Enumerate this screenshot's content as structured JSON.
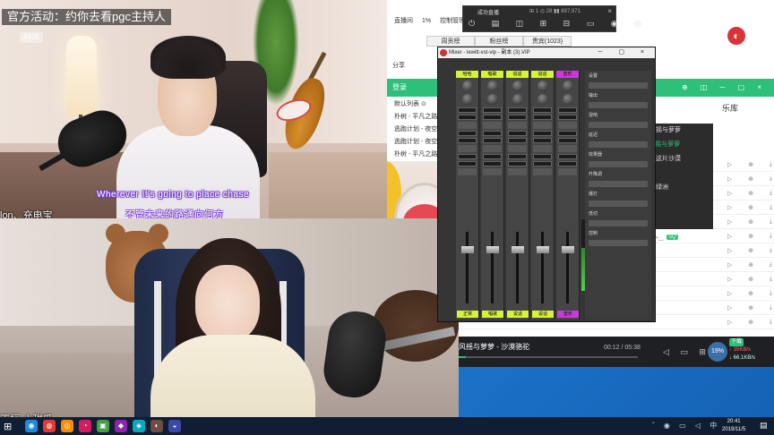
{
  "overlays": {
    "banner": "官方活动：约你去看pgc主持人",
    "game_name": "",
    "sub_badge": "8425",
    "lyric_en": "Wherever It's going to place chase",
    "lyric_cn": "不管未来的路通向何方",
    "streamer_top": "lon、充电宝",
    "streamer_bottom": "正恒-小甜瓜"
  },
  "stream_toolbar": {
    "title": "成功直播",
    "stats": "⊞ 1 ◎ 28 ▮▮ 897,971",
    "close": "×",
    "icons": "⏻ ▤ ◫ ⊞ ⊟ ▭ ◉ ◎"
  },
  "music_app": {
    "top_tabs": [
      "直播间",
      "1%",
      "控制管理"
    ],
    "tab_strip": [
      "周贡榜",
      "粉丝榜",
      "贵宾(1023)"
    ],
    "share": "分享",
    "login": "登录",
    "green_bar_icons": "⊕ ◫ ─ ▢ ×",
    "left_list_header": "默认列表 ⊙",
    "left_list": [
      "朴树 - 平凡之路 (",
      "逃跑计划 - 夜空中",
      "逃跑计划 - 夜空中",
      "朴树 - 平凡之路"
    ],
    "library": "乐库",
    "now_author": "作曲：风摇与萝萝",
    "now_title": "偷曲 - 风摇与萝萝",
    "now_line1": "我要穿越这片沙漠",
    "now_line2": "找到新的绿洲",
    "sq": "SQ",
    "sq_text": "个..."
  },
  "dark_popup": {
    "rows": [
      "作曲：风摇与萝萝",
      "偷曲 - 风摇与萝萝",
      "我要穿越这片沙漠",
      "",
      "找到新的绿洲"
    ],
    "play": "▶"
  },
  "player": {
    "track": "风摇与萝萝 - 沙漠骆驼",
    "time": "00:12 / 05:38",
    "progress": 0.04,
    "vol_icons": "◁ ▭ ⊞",
    "pct": "19%",
    "speed_chip": "下载",
    "speed_up": "↑ 35KB/s",
    "speed_down": "↓ 66.1KB/s"
  },
  "mixer": {
    "title": "Mixer - lewitt-vst-vip - 副本 (3).VIP",
    "win_buttons": "─ ▢ ×",
    "strips": [
      {
        "header": "哈哈",
        "footer": "正常",
        "color": "#d6f23a"
      },
      {
        "header": "唱歌",
        "footer": "唱歌",
        "color": "#d6f23a"
      },
      {
        "header": "说话",
        "footer": "说话",
        "color": "#d6f23a"
      },
      {
        "header": "说话",
        "footer": "说话",
        "color": "#d6f23a"
      },
      {
        "header": "音乐",
        "footer": "音乐",
        "color": "#c93bd6"
      }
    ],
    "master_labels": [
      "设置",
      "输出",
      "混响",
      "延迟",
      "效果器",
      "升降调",
      "爆灯",
      "低切",
      "控制"
    ]
  },
  "taskbar": {
    "start": "⊞",
    "apps": [
      {
        "label": "◉",
        "color": "#1e88e5"
      },
      {
        "label": "◍",
        "color": "#e53935"
      },
      {
        "label": "◎",
        "color": "#fb8c00"
      },
      {
        "label": "◔",
        "color": "#d81b60"
      },
      {
        "label": "▣",
        "color": "#43a047"
      },
      {
        "label": "◆",
        "color": "#8e24aa"
      },
      {
        "label": "◈",
        "color": "#00acc1"
      },
      {
        "label": "◐",
        "color": "#6d4c41"
      },
      {
        "label": "◒",
        "color": "#3949ab"
      }
    ],
    "tray": "ˆ ◉ ▭ ◁ 中",
    "time": "20:41",
    "date": "2019/11/5",
    "notify": "▤"
  },
  "colors": {
    "accent_green": "#2cc07a",
    "desktop_blue": "#1f7fd6",
    "lyric_outline": "#7a3fd0"
  }
}
